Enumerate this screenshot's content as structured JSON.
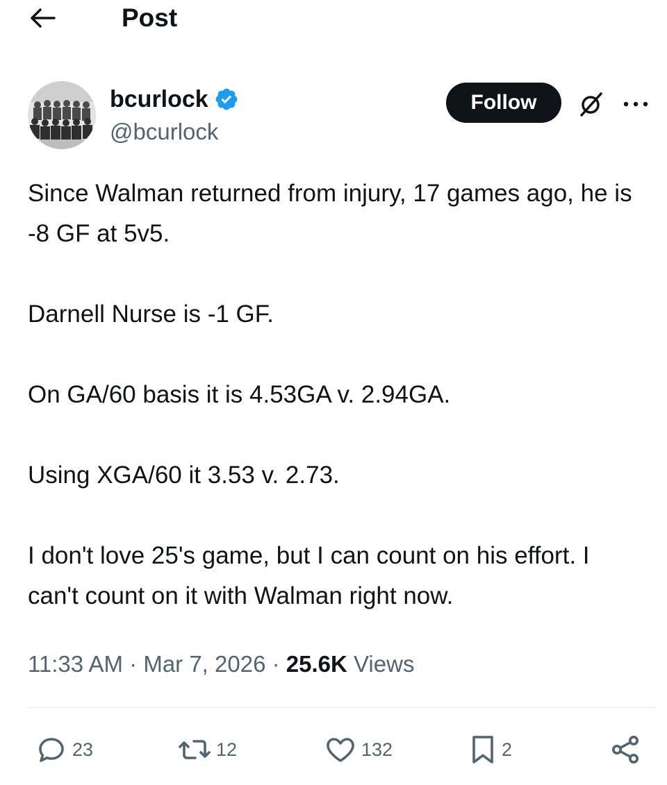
{
  "header": {
    "back_icon": "arrow-left-icon",
    "title": "Post"
  },
  "author": {
    "display_name": "bcurlock",
    "handle": "@bcurlock",
    "verified_icon": "verified-badge-icon",
    "verified_color": "#1d9bf0",
    "follow_label": "Follow",
    "grok_icon": "grok-icon",
    "more_icon": "more-dots-icon"
  },
  "tweet": {
    "paragraphs": [
      "Since Walman returned from injury, 17 games ago, he is -8 GF at 5v5.",
      "Darnell Nurse is -1 GF.",
      "On GA/60 basis it is 4.53GA v.  2.94GA.",
      "Using XGA/60 it 3.53 v. 2.73.",
      "I don't love 25's game, but I can count on his effort. I can't count on it with Walman right now."
    ],
    "time": "11:33 AM",
    "date": "Mar 7, 2026",
    "separator": "·",
    "views_count": "25.6K",
    "views_label": "Views"
  },
  "actions": {
    "replies": {
      "icon": "reply-icon",
      "count": "23"
    },
    "reposts": {
      "icon": "repost-icon",
      "count": "12"
    },
    "likes": {
      "icon": "heart-icon",
      "count": "132"
    },
    "bookmarks": {
      "icon": "bookmark-icon",
      "count": "2"
    },
    "share": {
      "icon": "share-icon"
    }
  },
  "colors": {
    "text_primary": "#0f1419",
    "text_secondary": "#536471",
    "follow_bg": "#0f1419",
    "divider": "#e6e9eb"
  }
}
